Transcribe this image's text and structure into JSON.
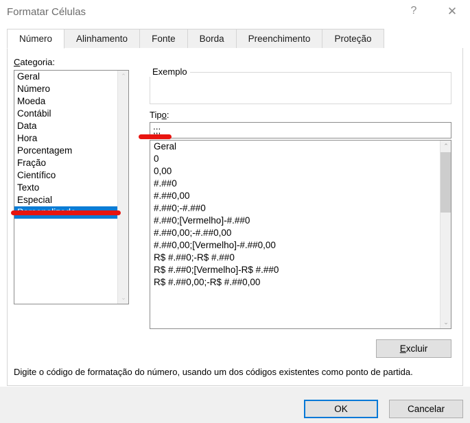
{
  "window": {
    "title": "Formatar Células",
    "help_icon": "question-mark-icon",
    "help_glyph": "?",
    "close_icon": "close-icon",
    "close_glyph": "✕"
  },
  "tabs": [
    {
      "label": "Número",
      "active": true
    },
    {
      "label": "Alinhamento",
      "active": false
    },
    {
      "label": "Fonte",
      "active": false
    },
    {
      "label": "Borda",
      "active": false
    },
    {
      "label": "Preenchimento",
      "active": false
    },
    {
      "label": "Proteção",
      "active": false
    }
  ],
  "category": {
    "label_prefix": "",
    "label_accel": "C",
    "label_suffix": "ategoria:",
    "items": [
      {
        "label": "Geral",
        "selected": false
      },
      {
        "label": "Número",
        "selected": false
      },
      {
        "label": "Moeda",
        "selected": false
      },
      {
        "label": "Contábil",
        "selected": false
      },
      {
        "label": "Data",
        "selected": false
      },
      {
        "label": "Hora",
        "selected": false
      },
      {
        "label": "Porcentagem",
        "selected": false
      },
      {
        "label": "Fração",
        "selected": false
      },
      {
        "label": "Científico",
        "selected": false
      },
      {
        "label": "Texto",
        "selected": false
      },
      {
        "label": "Especial",
        "selected": false
      },
      {
        "label": "Personalizado",
        "selected": true
      }
    ],
    "scroll_up_glyph": "⌃",
    "scroll_down_glyph": "⌄"
  },
  "example": {
    "title": "Exemplo",
    "value": ""
  },
  "type_field": {
    "label_prefix": "Tip",
    "label_accel": "o",
    "label_suffix": ":",
    "value": ";;;",
    "placeholder": ""
  },
  "format_list": {
    "items": [
      "Geral",
      "0",
      "0,00",
      "#.##0",
      "#.##0,00",
      "#.##0;-#.##0",
      "#.##0;[Vermelho]-#.##0",
      "#.##0,00;-#.##0,00",
      "#.##0,00;[Vermelho]-#.##0,00",
      "R$ #.##0;-R$ #.##0",
      "R$ #.##0;[Vermelho]-R$ #.##0",
      "R$ #.##0,00;-R$ #.##0,00"
    ],
    "scroll_up_glyph": "⌃",
    "scroll_down_glyph": "⌄"
  },
  "buttons": {
    "delete_prefix": "",
    "delete_accel": "E",
    "delete_suffix": "xcluir",
    "ok": "OK",
    "cancel": "Cancelar"
  },
  "description": "Digite o código de formatação do número, usando um dos códigos existentes como ponto de partida.",
  "annotations": {
    "colors": {
      "red": "#e8140f",
      "selection_blue": "#0c7cd5",
      "focus_blue": "#0078d7"
    }
  }
}
